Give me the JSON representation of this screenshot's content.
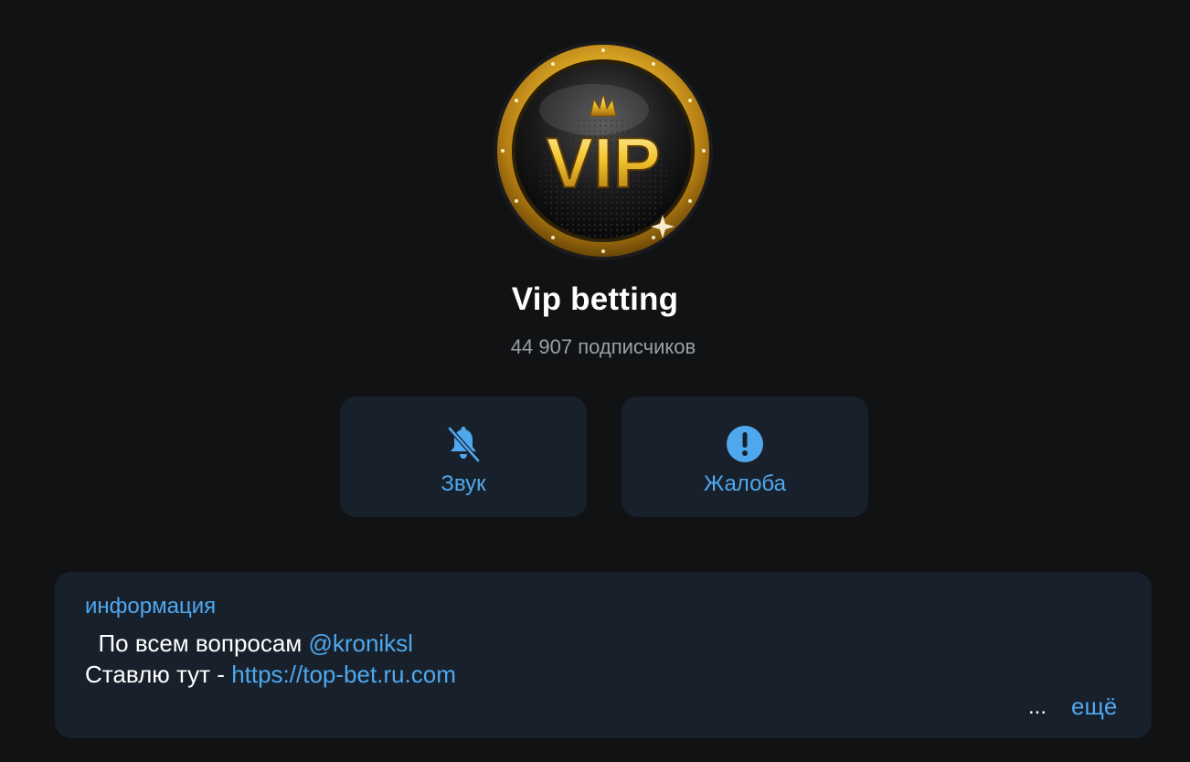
{
  "channel": {
    "title": "Vip betting",
    "subscribers": "44 907 подписчиков",
    "avatar_text": "VIP"
  },
  "actions": [
    {
      "label": "Звук",
      "icon": "bell-muted-icon"
    },
    {
      "label": "Жалоба",
      "icon": "exclamation-circle-icon"
    }
  ],
  "info": {
    "label": "информация",
    "line1_prefix": "  По всем вопросам ",
    "line1_link": "@kroniksl",
    "line2_prefix": "Ставлю тут - ",
    "line2_link": "https://top-bet.ru.com",
    "ellipsis": "...",
    "more": "ещё"
  },
  "colors": {
    "background": "#111214",
    "card": "#18212b",
    "accent": "#4fa8ee",
    "gold": "#e8b52a"
  }
}
